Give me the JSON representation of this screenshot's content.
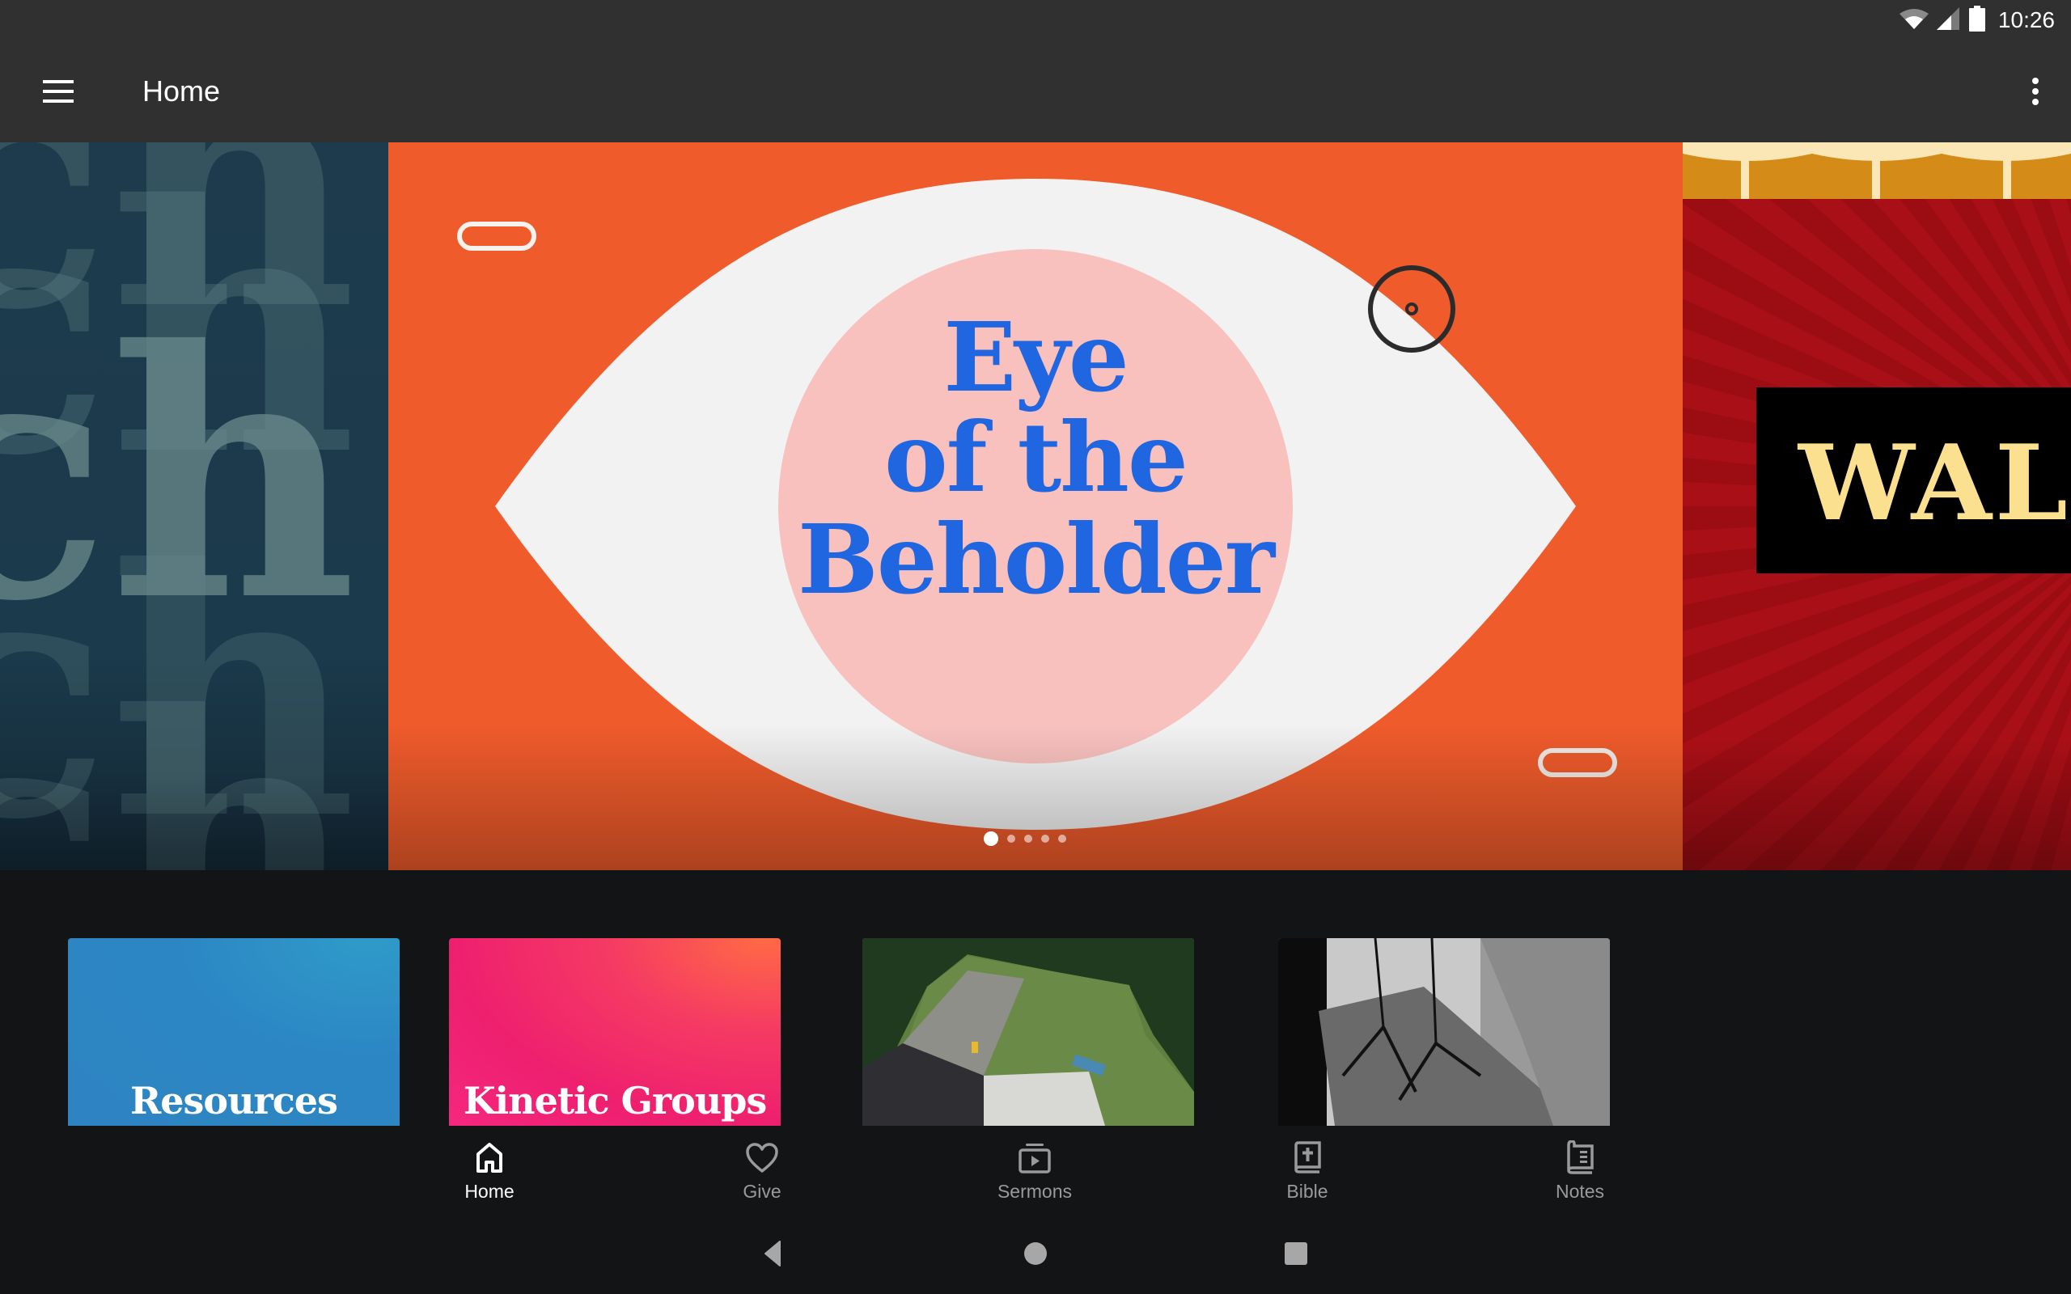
{
  "status_bar": {
    "time": "10:26",
    "icons": [
      "wifi-icon",
      "cellular-signal-icon",
      "battery-icon"
    ]
  },
  "app_bar": {
    "title": "Home",
    "menu_icon": "hamburger-menu-icon",
    "overflow_icon": "more-vert-icon"
  },
  "carousel": {
    "slides": [
      {
        "name": "previous-series",
        "visible_text": "ch"
      },
      {
        "name": "eye-of-the-beholder",
        "title_lines": [
          "Eye",
          "of the",
          "Beholder"
        ]
      },
      {
        "name": "next-series",
        "visible_text": "WAL"
      }
    ],
    "page_count": 5,
    "active_page": 1,
    "colors": {
      "main_bg": "#ef5b2b",
      "pupil_pink": "#f8c1be",
      "title_blue": "#1f66e0",
      "eye_white": "#f2f2f2",
      "left_bg": "#1b3a4b",
      "right_bg": "#a80f16",
      "marquee_text": "#fbe08f"
    }
  },
  "tiles": [
    {
      "label": "Resources",
      "kind": "gradient-blue"
    },
    {
      "label": "Kinetic Groups",
      "kind": "gradient-pink"
    },
    {
      "label": "",
      "kind": "aerial-photo"
    },
    {
      "label": "",
      "kind": "bw-stage-photo"
    }
  ],
  "bottom_nav": {
    "items": [
      {
        "label": "Home",
        "icon": "home-icon",
        "active": true
      },
      {
        "label": "Give",
        "icon": "heart-icon",
        "active": false
      },
      {
        "label": "Sermons",
        "icon": "video-library-icon",
        "active": false
      },
      {
        "label": "Bible",
        "icon": "bible-book-icon",
        "active": false
      },
      {
        "label": "Notes",
        "icon": "notes-book-icon",
        "active": false
      }
    ]
  },
  "system_nav": {
    "buttons": [
      "back-button",
      "home-button",
      "recents-button"
    ]
  }
}
